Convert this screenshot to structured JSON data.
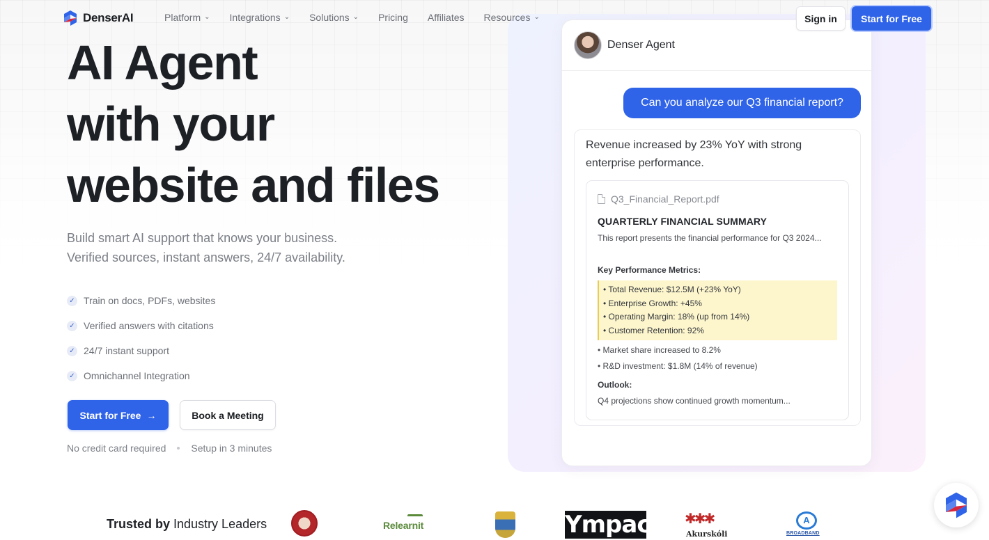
{
  "brand": {
    "name": "DenserAI",
    "primary": "#2f63e8"
  },
  "nav": {
    "items": [
      {
        "label": "Platform",
        "has_dropdown": true
      },
      {
        "label": "Integrations",
        "has_dropdown": true
      },
      {
        "label": "Solutions",
        "has_dropdown": true
      },
      {
        "label": "Pricing",
        "has_dropdown": false
      },
      {
        "label": "Affiliates",
        "has_dropdown": false
      },
      {
        "label": "Resources",
        "has_dropdown": true
      }
    ],
    "sign_in": "Sign in",
    "start_free": "Start for Free"
  },
  "hero": {
    "title_lines": [
      "AI Agent",
      "with your",
      "website and files"
    ],
    "subtitle_lines": [
      "Build smart AI support that knows your business.",
      "Verified sources, instant answers, 24/7 availability."
    ],
    "features": [
      "Train on docs, PDFs, websites",
      "Verified answers with citations",
      "24/7 instant support",
      "Omnichannel Integration"
    ],
    "cta_primary": "Start for Free",
    "cta_secondary": "Book a Meeting",
    "notes": [
      "No credit card required",
      "Setup in 3 minutes"
    ]
  },
  "chat": {
    "agent_name": "Denser Agent",
    "user_message": "Can you analyze our Q3 financial report?",
    "reply": "Revenue increased by 23% YoY with strong enterprise performance.",
    "document": {
      "file_name": "Q3_Financial_Report.pdf",
      "title": "QUARTERLY FINANCIAL SUMMARY",
      "intro": "This report presents the financial performance for Q3 2024...",
      "key_heading": "Key Performance Metrics:",
      "highlighted": [
        "• Total Revenue: $12.5M (+23% YoY)",
        "• Enterprise Growth: +45%",
        "• Operating Margin: 18% (up from 14%)",
        "• Customer Retention: 92%"
      ],
      "extra": [
        "• Market share increased to 8.2%",
        "• R&D investment: $1.8M (14% of revenue)"
      ],
      "outlook_heading": "Outlook:",
      "outlook_text": "Q4 projections show continued growth momentum..."
    }
  },
  "trusted": {
    "bold": "Trusted by",
    "rest": " Industry Leaders",
    "logos": {
      "relearnit": "Relearnit",
      "impact": "Ympact",
      "akurskoll": "Akurskóli",
      "broadband": "BROADBAND"
    }
  }
}
